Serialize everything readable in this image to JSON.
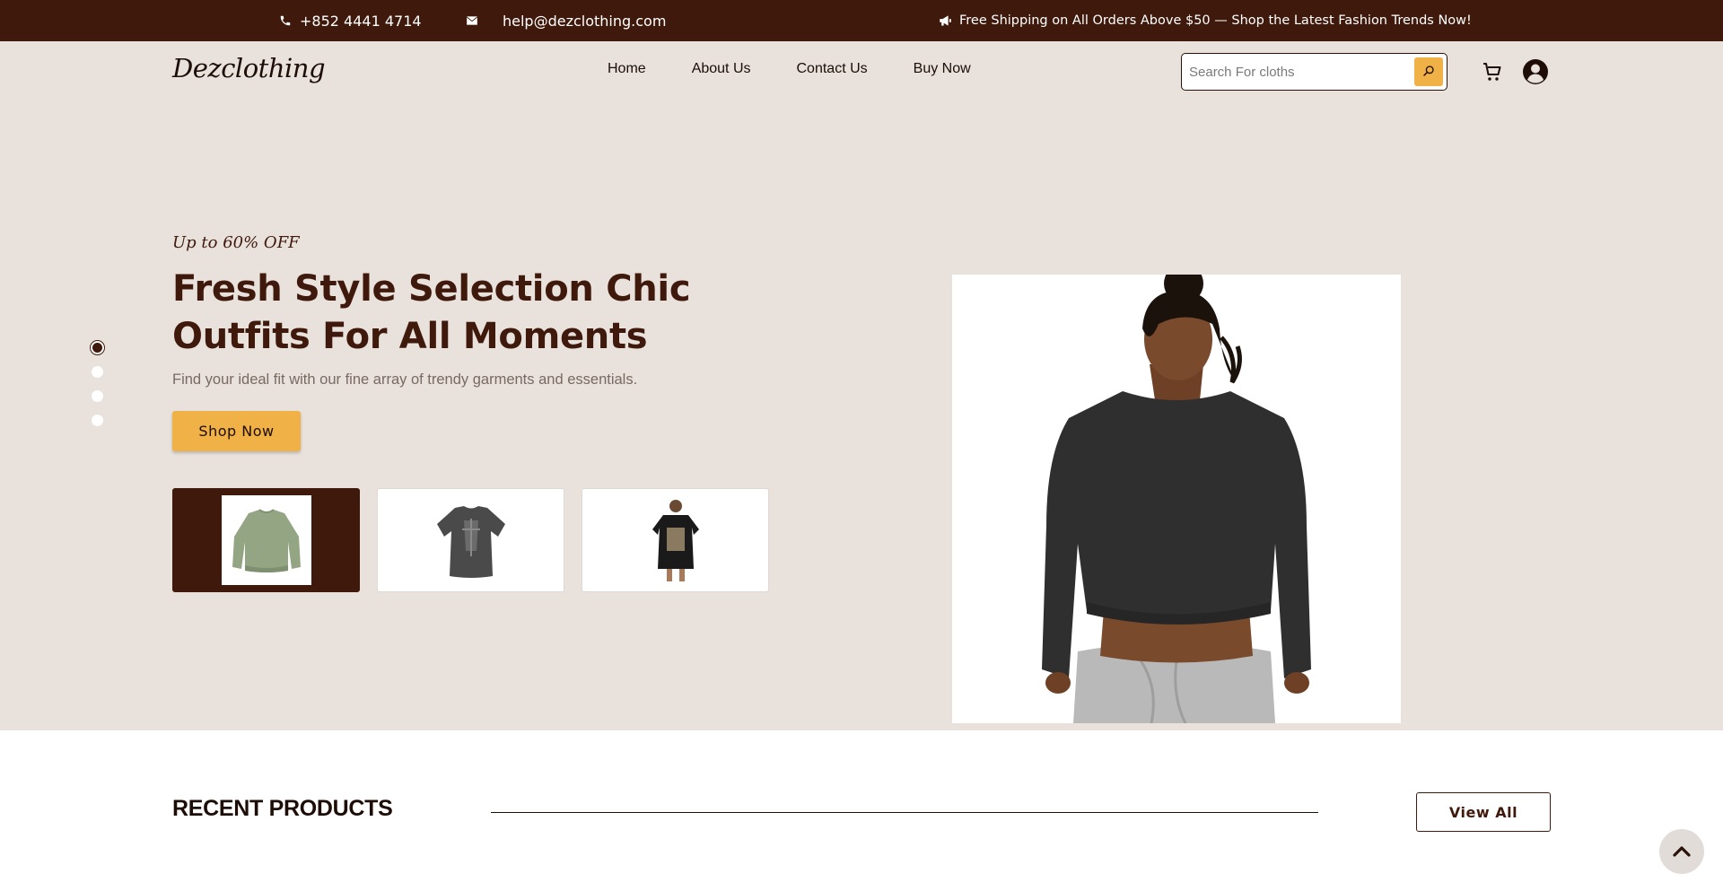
{
  "topbar": {
    "phone": "+852 4441 4714",
    "email": "help@dezclothing.com",
    "promo": "Free Shipping on All Orders Above $50 — Shop the Latest Fashion Trends Now!",
    "icons": [
      "phone-icon",
      "mail-icon",
      "megaphone-icon"
    ]
  },
  "header": {
    "logo": "Dezclothing",
    "nav": [
      "Home",
      "About Us",
      "Contact Us",
      "Buy Now"
    ],
    "search_placeholder": "Search For cloths",
    "icons": [
      "search-icon",
      "cart-icon",
      "user-icon"
    ]
  },
  "hero": {
    "tagline": "Up to 60% OFF",
    "headline": "Fresh Style Selection Chic Outfits For All Moments",
    "subtext": "Find your ideal fit with our fine array of trendy garments and essentials.",
    "cta": "Shop Now",
    "slider_dots": 4,
    "active_slide": 1,
    "thumbnails": [
      "sage green cropped sweatshirt",
      "charcoal graphic t-shirt",
      "black oversized graphic tee dress"
    ],
    "active_thumbnail": 1,
    "image": "black cropped sweatshirt with grey joggers"
  },
  "recent": {
    "title": "RECENT PRODUCTS",
    "view_all": "View All"
  },
  "colors": {
    "brand_dark": "#3f190b",
    "accent": "#f0b247",
    "hero_bg": "#e8e1dc"
  }
}
